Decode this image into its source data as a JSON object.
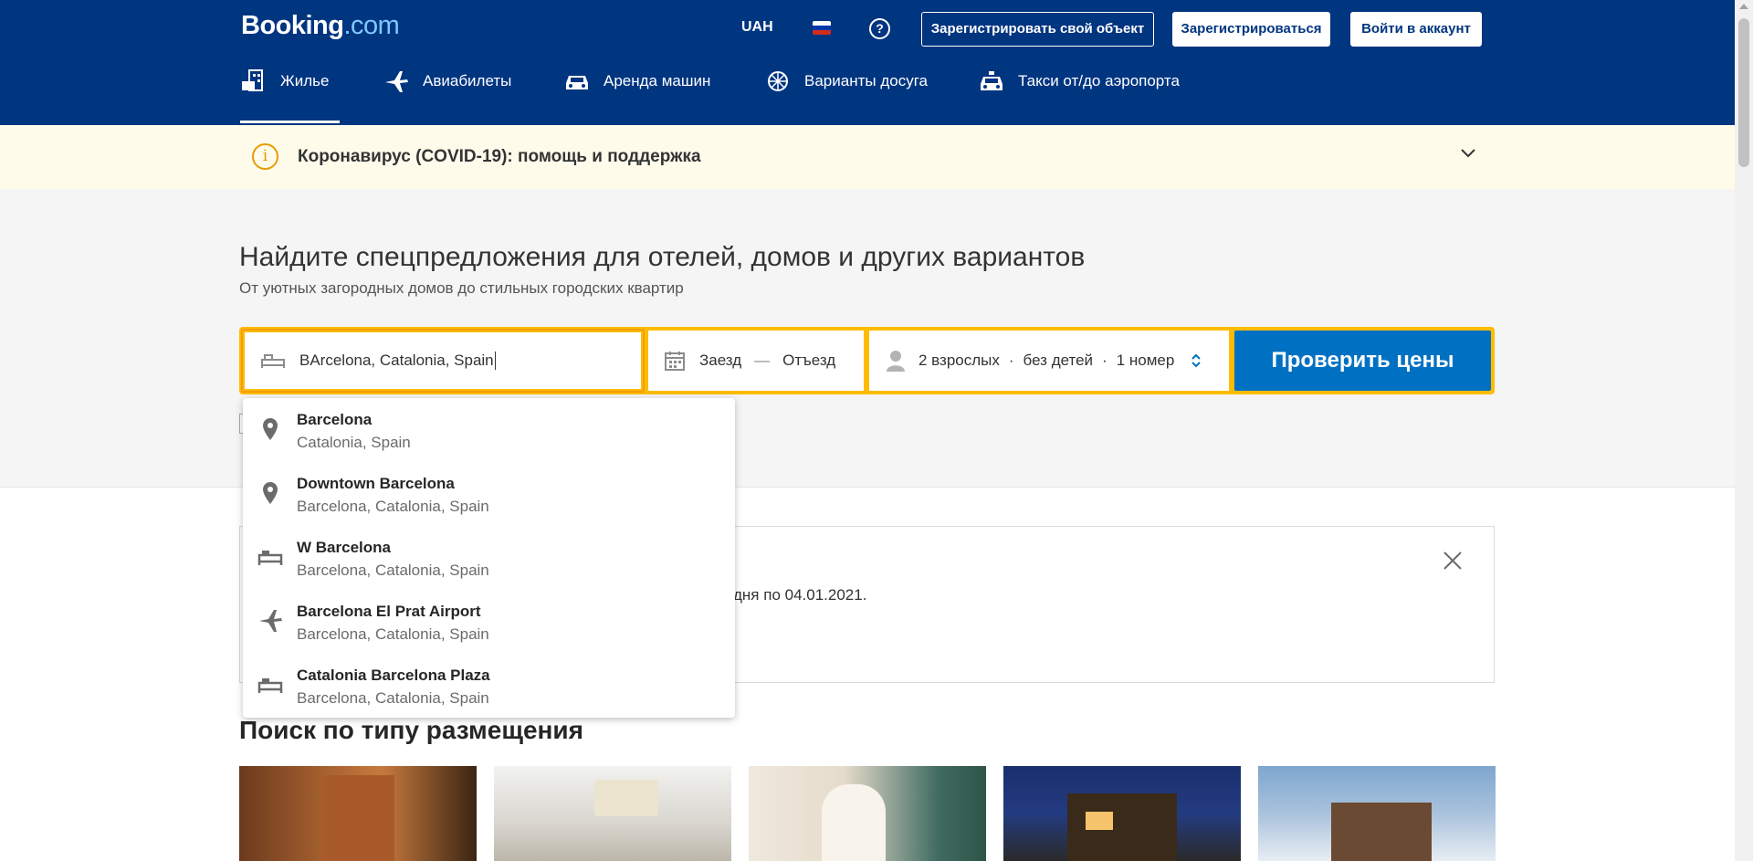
{
  "header": {
    "logo_main": "Booking",
    "logo_suffix": ".com",
    "currency": "UAH",
    "help_glyph": "?",
    "register_property": "Зарегистрировать свой объект",
    "register": "Зарегистрироваться",
    "login": "Войти в аккаунт",
    "flag": "russia-flag"
  },
  "nav": [
    {
      "label": "Жилье",
      "icon": "bed-building-icon",
      "active": true
    },
    {
      "label": "Авиабилеты",
      "icon": "plane-icon"
    },
    {
      "label": "Аренда машин",
      "icon": "car-icon"
    },
    {
      "label": "Варианты досуга",
      "icon": "ferris-wheel-icon"
    },
    {
      "label": "Такси от/до аэропорта",
      "icon": "taxi-icon"
    }
  ],
  "covid": {
    "info_glyph": "i",
    "text": "Коронавирус (COVID-19): помощь и поддержка"
  },
  "hero": {
    "title": "Найдите спецпредложения для отелей, домов и других вариантов",
    "subtitle": "От уютных загородных домов до стильных городских квартир"
  },
  "search": {
    "destination_value": "BArcelona, Catalonia, Spain",
    "checkin": "Заезд",
    "dash": "—",
    "checkout": "Отъезд",
    "adults": "2 взрослых",
    "children": "без детей",
    "rooms": "1 номер",
    "sep": "·",
    "submit": "Проверить цены"
  },
  "notice": {
    "fragment": "дня по 04.01.2021."
  },
  "suggestions": [
    {
      "title": "Barcelona",
      "subtitle": "Catalonia, Spain",
      "icon": "map-pin-icon"
    },
    {
      "title": "Downtown Barcelona",
      "subtitle": "Barcelona, Catalonia, Spain",
      "icon": "map-pin-icon"
    },
    {
      "title": "W Barcelona",
      "subtitle": "Barcelona, Catalonia, Spain",
      "icon": "bed-icon"
    },
    {
      "title": "Barcelona El Prat Airport",
      "subtitle": "Barcelona, Catalonia, Spain",
      "icon": "plane-icon"
    },
    {
      "title": "Catalonia Barcelona Plaza",
      "subtitle": "Barcelona, Catalonia, Spain",
      "icon": "bed-icon"
    }
  ],
  "section": {
    "title": "Поиск по типу размещения"
  },
  "colors": {
    "brand_blue": "#003580",
    "accent_yellow": "#febb02",
    "cta_blue": "#0071c2",
    "banner_bg": "#fffbeb"
  }
}
